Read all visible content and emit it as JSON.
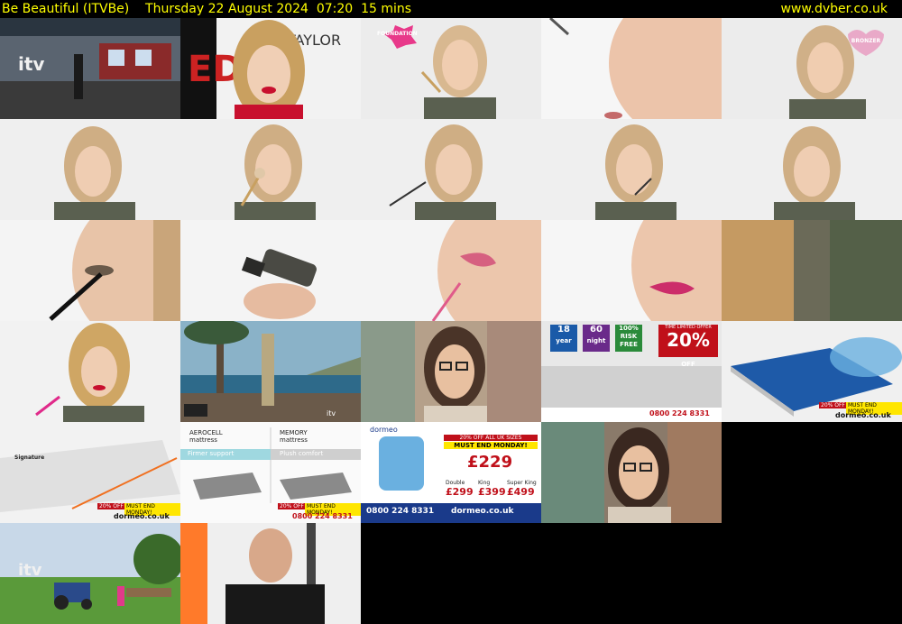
{
  "header": {
    "left_text": "Be Beautiful (ITVBe)    Thursday 22 August 2024  07:20  15 mins",
    "site": "www.dvber.co.uk"
  },
  "thumbs": {
    "t3": {
      "badge": "FOUNDATION"
    },
    "t5": {
      "badge": "BRONZER"
    },
    "t19": {
      "b1": "18",
      "b1s": "year",
      "b2": "60",
      "b2s": "night",
      "b3": "100% RISK FREE",
      "offer": "20%",
      "offer_sub": "OFF",
      "offer_top": "TIME LIMITED OFFER",
      "phone": "0800 224 8331"
    },
    "t20": {
      "offer": "20% OFF",
      "must": "MUST END MONDAY!",
      "brand": "dormeo.co.uk"
    },
    "t21": {
      "title": "Signature",
      "offer": "20% OFF",
      "must": "MUST END MONDAY!",
      "brand": "dormeo.co.uk"
    },
    "t22": {
      "col1a": "AEROCELL",
      "col1b": "mattress",
      "col2a": "MEMORY",
      "col2b": "mattress",
      "firm": "Firmer support",
      "plush": "Plush comfort",
      "offer": "20% OFF",
      "must": "MUST END MONDAY!",
      "phone": "0800 224 8331"
    },
    "t23": {
      "brand_top": "dormeo",
      "headline": "20% OFF ALL UK SIZES",
      "must": "MUST END MONDAY!",
      "price": "£229",
      "p1": "£299",
      "p2": "£399",
      "p3": "£499",
      "l1": "Double",
      "l2": "King",
      "l3": "Super King",
      "phone": "0800 224 8331",
      "site": "dormeo.co.uk"
    }
  }
}
